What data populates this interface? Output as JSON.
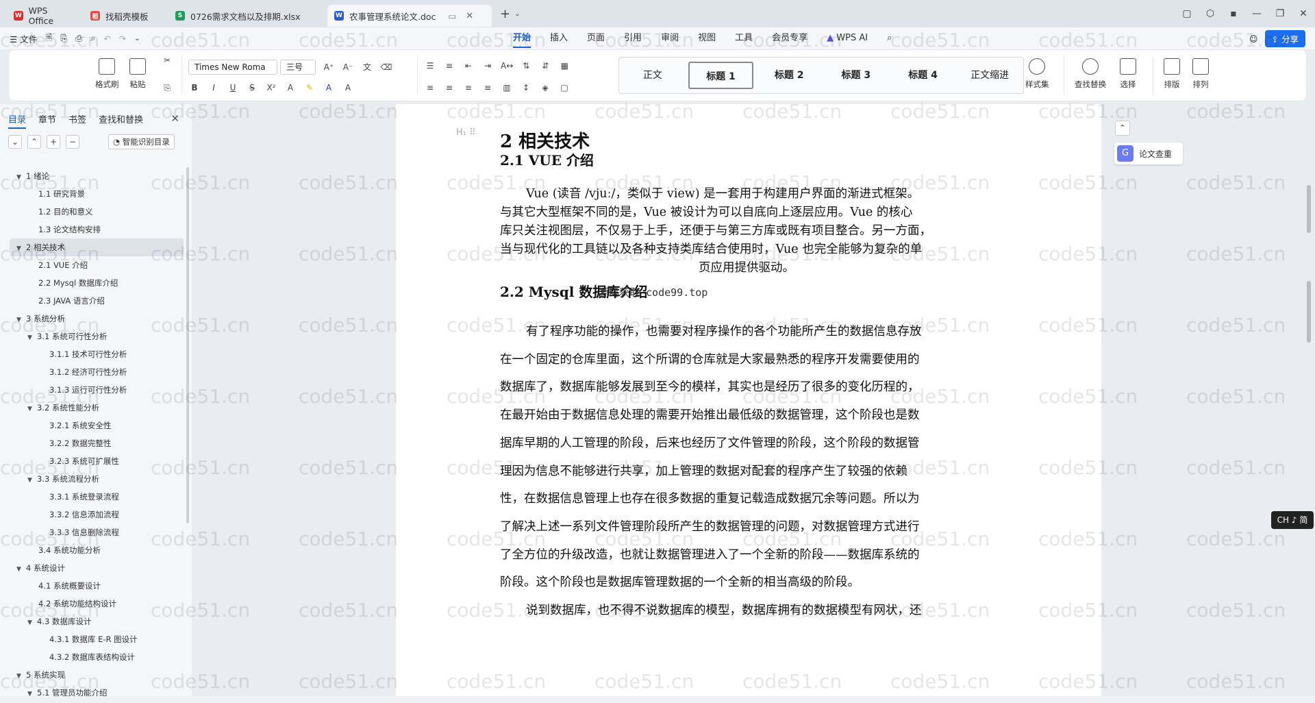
{
  "tabs": [
    {
      "label": "WPS Office",
      "icon": "wps-logo-icon",
      "color": "#e02b2b"
    },
    {
      "label": "找稻壳模板",
      "icon": "docer-icon",
      "color": "#e64a3d"
    },
    {
      "label": "0726需求文档以及排期.xlsx",
      "icon": "sheet-icon",
      "color": "#1f9d55"
    },
    {
      "label": "农事管理系统论文.doc",
      "icon": "word-icon",
      "color": "#2b5cd8"
    }
  ],
  "menu": {
    "file": "文件",
    "tabs": [
      "开始",
      "插入",
      "页面",
      "引用",
      "审阅",
      "视图",
      "工具",
      "会员专享"
    ],
    "wps_ai": "WPS AI",
    "share": "分享"
  },
  "ribbon": {
    "format_painter": "格式刷",
    "paste": "粘贴",
    "font_name": "Times New Roma",
    "font_size": "三号",
    "styles": [
      "正文",
      "标题 1",
      "标题 2",
      "标题 3",
      "标题 4",
      "正文缩进"
    ],
    "style_set": "样式集",
    "find_replace": "查找替换",
    "select": "选择",
    "layout": "排版",
    "arrange": "排列"
  },
  "sidebar": {
    "tabs": [
      "目录",
      "章节",
      "书签",
      "查找和替换"
    ],
    "smart_toc": "智能识别目录",
    "items": [
      {
        "level": 1,
        "text": "1 绪论",
        "arrow": true
      },
      {
        "level": 2,
        "text": "1.1 研究背景"
      },
      {
        "level": 2,
        "text": "1.2 目的和意义"
      },
      {
        "level": 2,
        "text": "1.3 论文结构安排"
      },
      {
        "level": 1,
        "text": "2 相关技术",
        "arrow": true,
        "hl": true
      },
      {
        "level": 2,
        "text": "2.1 VUE 介绍"
      },
      {
        "level": 2,
        "text": "2.2 Mysql 数据库介绍"
      },
      {
        "level": 2,
        "text": "2.3 JAVA 语言介绍"
      },
      {
        "level": 1,
        "text": "3 系统分析",
        "arrow": true
      },
      {
        "level": 2,
        "text": "3.1 系统可行性分析",
        "arrow": true
      },
      {
        "level": 3,
        "text": "3.1.1 技术可行性分析"
      },
      {
        "level": 3,
        "text": "3.1.2 经济可行性分析"
      },
      {
        "level": 3,
        "text": "3.1.3 运行可行性分析"
      },
      {
        "level": 2,
        "text": "3.2 系统性能分析",
        "arrow": true
      },
      {
        "level": 3,
        "text": "3.2.1 系统安全性"
      },
      {
        "level": 3,
        "text": "3.2.2 数据完整性"
      },
      {
        "level": 3,
        "text": "3.2.3 系统可扩展性"
      },
      {
        "level": 2,
        "text": "3.3 系统流程分析",
        "arrow": true
      },
      {
        "level": 3,
        "text": "3.3.1 系统登录流程"
      },
      {
        "level": 3,
        "text": "3.3.2 信息添加流程"
      },
      {
        "level": 3,
        "text": "3.3.3 信息删除流程"
      },
      {
        "level": 2,
        "text": "3.4 系统功能分析"
      },
      {
        "level": 1,
        "text": "4 系统设计",
        "arrow": true
      },
      {
        "level": 2,
        "text": "4.1 系统概要设计"
      },
      {
        "level": 2,
        "text": "4.2 系统功能结构设计"
      },
      {
        "level": 2,
        "text": "4.3 数据库设计",
        "arrow": true
      },
      {
        "level": 3,
        "text": "4.3.1 数据库 E-R 图设计"
      },
      {
        "level": 3,
        "text": "4.3.2 数据库表结构设计"
      },
      {
        "level": 1,
        "text": "5 系统实现",
        "arrow": true
      },
      {
        "level": 2,
        "text": "5.1 管理员功能介绍",
        "arrow": true
      }
    ]
  },
  "doc": {
    "h1": "2  相关技术",
    "h2_1": "2.1 VUE 介绍",
    "p1": [
      "Vue (读音 /vjuː/，类似于 view) 是一套用于构建用户界面的渐进式框架。",
      "与其它大型框架不同的是，Vue 被设计为可以自底向上逐层应用。Vue 的核心",
      "库只关注视图层，不仅易于上手，还便于与第三方库或既有项目整合。另一方面，",
      "当与现代化的工具链以及各种支持类库结合使用时，Vue 也完全能够为复杂的单",
      "页应用提供驱动。"
    ],
    "h2_2": "2.2 Mysql 数据库介绍",
    "source_mark": "源码获取 code99.top",
    "p2": [
      "有了程序功能的操作，也需要对程序操作的各个功能所产生的数据信息存放",
      "在一个固定的仓库里面，这个所谓的仓库就是大家最熟悉的程序开发需要使用的",
      "数据库了，数据库能够发展到至今的模样，其实也是经历了很多的变化历程的，",
      "在最开始由于数据信息处理的需要开始推出最低级的数据管理，这个阶段也是数",
      "据库早期的人工管理的阶段，后来也经历了文件管理的阶段，这个阶段的数据管",
      "理因为信息不能够进行共享，加上管理的数据对配套的程序产生了较强的依赖",
      "性，在数据信息管理上也存在很多数据的重复记载造成数据冗余等问题。所以为",
      "了解决上述一系列文件管理阶段所产生的数据管理的问题，对数据管理方式进行",
      "了全方位的升级改造，也就让数据管理进入了一个全新的阶段——数据库系统的",
      "阶段。这个阶段也是数据库管理数据的一个全新的相当高级的阶段。",
      "说到数据库，也不得不说数据库的模型，数据库拥有的数据模型有网状，还"
    ]
  },
  "right": {
    "dedup": "论文查重"
  },
  "ime": "CH ♪ 简",
  "watermark": "code51.cn"
}
